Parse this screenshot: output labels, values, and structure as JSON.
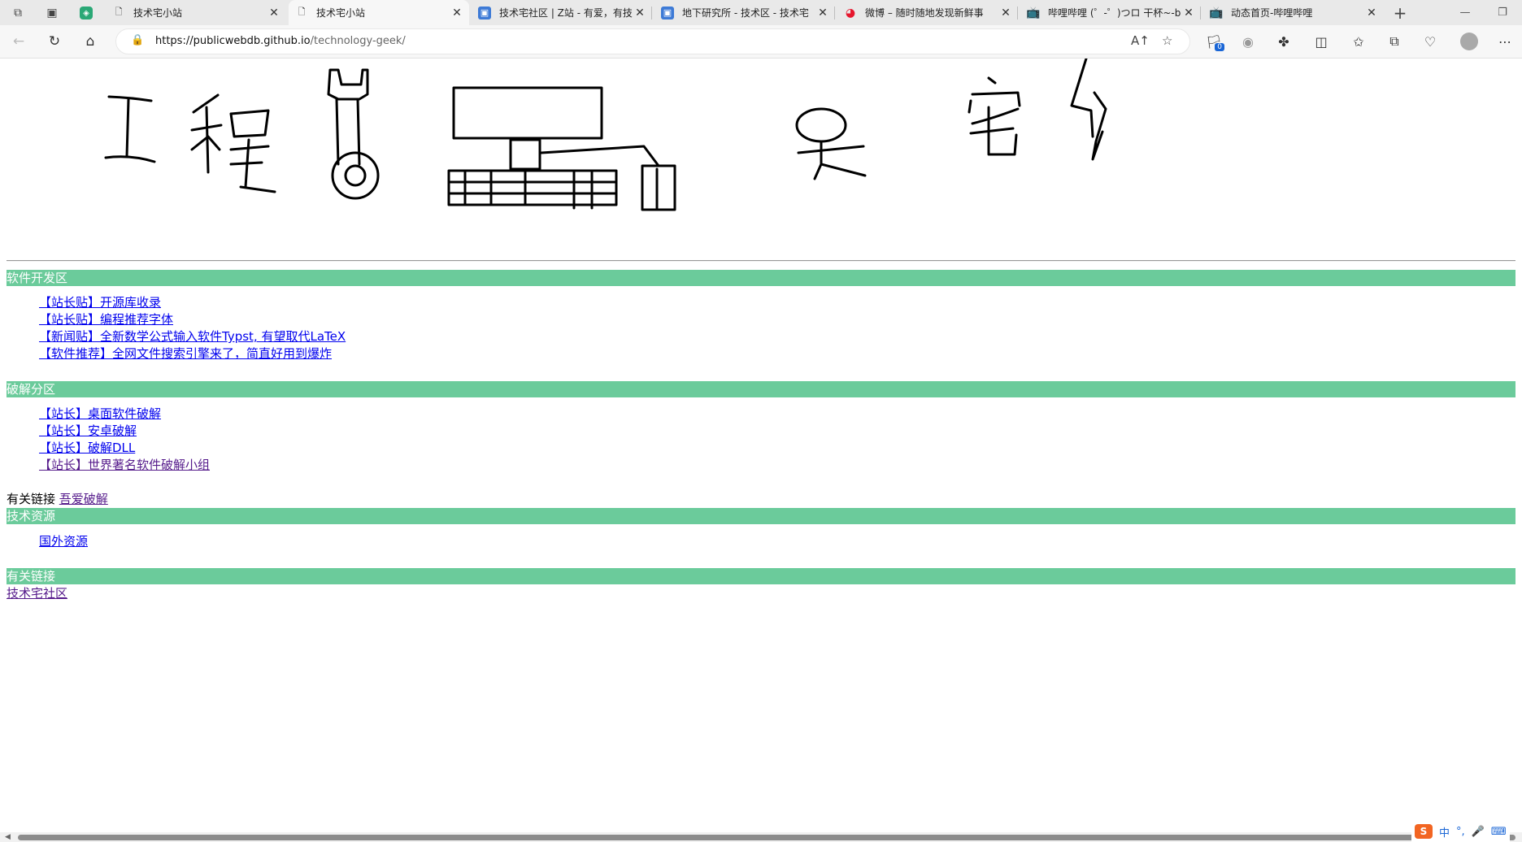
{
  "browser": {
    "tabs": [
      {
        "title": "技术宅小站",
        "icon": "page-icon",
        "active": false
      },
      {
        "title": "技术宅小站",
        "icon": "page-icon",
        "active": true
      },
      {
        "title": "技术宅社区 | Z站 - 有爱，有技",
        "icon": "bilibili-like-icon",
        "active": false
      },
      {
        "title": "地下研究所 - 技术区 - 技术宅",
        "icon": "bilibili-like-icon",
        "active": false
      },
      {
        "title": "微博 – 随时随地发现新鲜事",
        "icon": "weibo-icon",
        "active": false
      },
      {
        "title": "哔哩哔哩 (゜-゜)つロ 干杯~-b",
        "icon": "bilibili-icon",
        "active": false
      },
      {
        "title": "动态首页-哔哩哔哩",
        "icon": "bilibili-icon",
        "active": false
      }
    ],
    "address": {
      "host": "https://publicwebdb.github.io",
      "path": "/technology-geek/"
    },
    "extension_badge": "0"
  },
  "page": {
    "banner_text": {
      "left": "工程",
      "right": "宅"
    },
    "sections": [
      {
        "title": "软件开发区",
        "links": [
          "【站长贴】开源库收录",
          "【站长贴】编程推荐字体",
          "【新闻贴】全新数学公式输入软件Typst, 有望取代LaTeX",
          "【软件推荐】全网文件搜索引擎来了，简直好用到爆炸"
        ]
      },
      {
        "title": "破解分区",
        "links": [
          "【站长】桌面软件破解",
          "【站长】安卓破解",
          "【站长】破解DLL",
          "【站长】世界著名软件破解小组"
        ],
        "related_label": "有关链接",
        "related_link": "吾爱破解"
      },
      {
        "title": "技术资源",
        "links": [
          "国外资源"
        ]
      },
      {
        "title": "有关链接",
        "links": [
          "技术宅社区"
        ]
      }
    ]
  },
  "ime": {
    "lang": "中",
    "punct": "°,",
    "mic": "🎤",
    "keyboard": "⌨"
  }
}
